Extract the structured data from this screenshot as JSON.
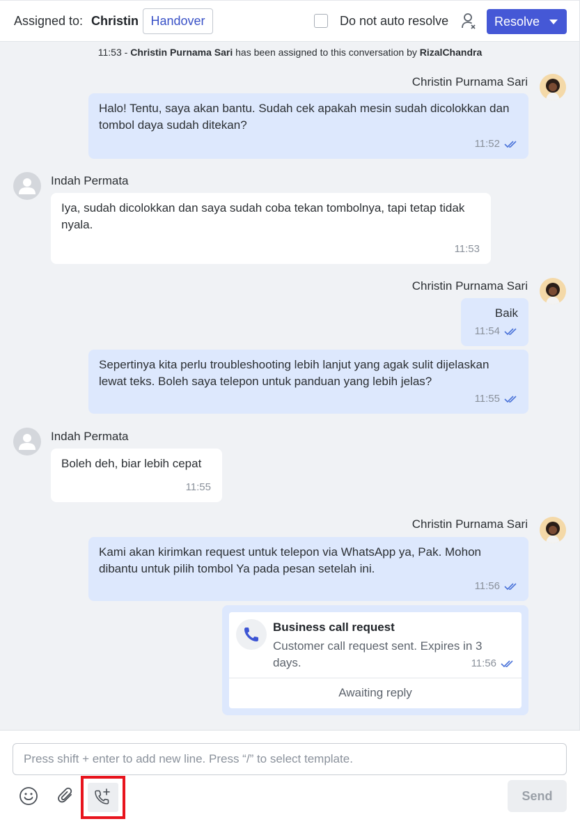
{
  "header": {
    "assigned_label": "Assigned to:",
    "assignee": "Christin",
    "handover_label": "Handover",
    "auto_resolve_label": "Do not auto resolve",
    "resolve_label": "Resolve"
  },
  "system_message": {
    "time": "11:53",
    "separator": "-",
    "agent": "Christin Purnama Sari",
    "text": "has been assigned to this conversation by",
    "assigner": "RizalChandra"
  },
  "messages": [
    {
      "sender": "Christin Purnama Sari",
      "text": "Halo! Tentu, saya akan bantu. Sudah cek apakah mesin sudah dicolokkan dan tombol daya sudah ditekan?",
      "time": "11:52"
    },
    {
      "sender": "Indah Permata",
      "text": "Iya, sudah dicolokkan dan saya sudah coba tekan tombolnya, tapi tetap tidak nyala.",
      "time": "11:53"
    },
    {
      "sender": "Christin Purnama Sari",
      "text": "Baik",
      "time": "11:54"
    },
    {
      "sender": "",
      "text": "Sepertinya kita perlu troubleshooting lebih lanjut yang agak sulit dijelaskan lewat teks. Boleh saya telepon untuk panduan yang lebih jelas?",
      "time": "11:55"
    },
    {
      "sender": "Indah Permata",
      "text": "Boleh deh, biar lebih cepat",
      "time": "11:55"
    },
    {
      "sender": "Christin Purnama Sari",
      "text": "Kami akan kirimkan request untuk telepon via WhatsApp ya, Pak. Mohon dibantu untuk pilih tombol Ya pada pesan setelah ini.",
      "time": "11:56"
    }
  ],
  "call_request": {
    "title": "Business call request",
    "description": "Customer call request sent. Expires in 3 days.",
    "time": "11:56",
    "status": "Awaiting reply"
  },
  "composer": {
    "placeholder": "Press shift + enter to add new line. Press “/” to select template.",
    "send_label": "Send"
  },
  "colors": {
    "accent": "#4558d6",
    "agent_bubble": "#dde8fd",
    "chat_background": "#f0f2f5",
    "highlight": "#e8141d"
  },
  "icons": [
    "user-x-icon",
    "double-check-icon",
    "phone-icon",
    "emoji-icon",
    "paperclip-icon",
    "phone-plus-icon",
    "avatar-placeholder-icon"
  ]
}
